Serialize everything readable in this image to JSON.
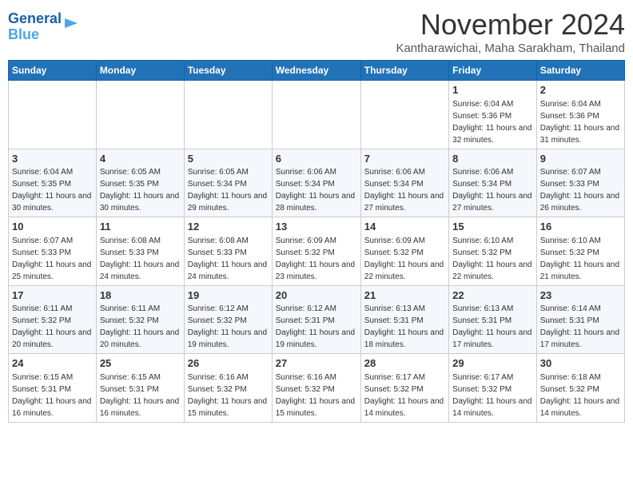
{
  "header": {
    "logo_line1": "General",
    "logo_line2": "Blue",
    "month": "November 2024",
    "location": "Kantharawichai, Maha Sarakham, Thailand"
  },
  "days_of_week": [
    "Sunday",
    "Monday",
    "Tuesday",
    "Wednesday",
    "Thursday",
    "Friday",
    "Saturday"
  ],
  "weeks": [
    [
      {
        "day": "",
        "info": ""
      },
      {
        "day": "",
        "info": ""
      },
      {
        "day": "",
        "info": ""
      },
      {
        "day": "",
        "info": ""
      },
      {
        "day": "",
        "info": ""
      },
      {
        "day": "1",
        "info": "Sunrise: 6:04 AM\nSunset: 5:36 PM\nDaylight: 11 hours and 32 minutes."
      },
      {
        "day": "2",
        "info": "Sunrise: 6:04 AM\nSunset: 5:36 PM\nDaylight: 11 hours and 31 minutes."
      }
    ],
    [
      {
        "day": "3",
        "info": "Sunrise: 6:04 AM\nSunset: 5:35 PM\nDaylight: 11 hours and 30 minutes."
      },
      {
        "day": "4",
        "info": "Sunrise: 6:05 AM\nSunset: 5:35 PM\nDaylight: 11 hours and 30 minutes."
      },
      {
        "day": "5",
        "info": "Sunrise: 6:05 AM\nSunset: 5:34 PM\nDaylight: 11 hours and 29 minutes."
      },
      {
        "day": "6",
        "info": "Sunrise: 6:06 AM\nSunset: 5:34 PM\nDaylight: 11 hours and 28 minutes."
      },
      {
        "day": "7",
        "info": "Sunrise: 6:06 AM\nSunset: 5:34 PM\nDaylight: 11 hours and 27 minutes."
      },
      {
        "day": "8",
        "info": "Sunrise: 6:06 AM\nSunset: 5:34 PM\nDaylight: 11 hours and 27 minutes."
      },
      {
        "day": "9",
        "info": "Sunrise: 6:07 AM\nSunset: 5:33 PM\nDaylight: 11 hours and 26 minutes."
      }
    ],
    [
      {
        "day": "10",
        "info": "Sunrise: 6:07 AM\nSunset: 5:33 PM\nDaylight: 11 hours and 25 minutes."
      },
      {
        "day": "11",
        "info": "Sunrise: 6:08 AM\nSunset: 5:33 PM\nDaylight: 11 hours and 24 minutes."
      },
      {
        "day": "12",
        "info": "Sunrise: 6:08 AM\nSunset: 5:33 PM\nDaylight: 11 hours and 24 minutes."
      },
      {
        "day": "13",
        "info": "Sunrise: 6:09 AM\nSunset: 5:32 PM\nDaylight: 11 hours and 23 minutes."
      },
      {
        "day": "14",
        "info": "Sunrise: 6:09 AM\nSunset: 5:32 PM\nDaylight: 11 hours and 22 minutes."
      },
      {
        "day": "15",
        "info": "Sunrise: 6:10 AM\nSunset: 5:32 PM\nDaylight: 11 hours and 22 minutes."
      },
      {
        "day": "16",
        "info": "Sunrise: 6:10 AM\nSunset: 5:32 PM\nDaylight: 11 hours and 21 minutes."
      }
    ],
    [
      {
        "day": "17",
        "info": "Sunrise: 6:11 AM\nSunset: 5:32 PM\nDaylight: 11 hours and 20 minutes."
      },
      {
        "day": "18",
        "info": "Sunrise: 6:11 AM\nSunset: 5:32 PM\nDaylight: 11 hours and 20 minutes."
      },
      {
        "day": "19",
        "info": "Sunrise: 6:12 AM\nSunset: 5:32 PM\nDaylight: 11 hours and 19 minutes."
      },
      {
        "day": "20",
        "info": "Sunrise: 6:12 AM\nSunset: 5:31 PM\nDaylight: 11 hours and 19 minutes."
      },
      {
        "day": "21",
        "info": "Sunrise: 6:13 AM\nSunset: 5:31 PM\nDaylight: 11 hours and 18 minutes."
      },
      {
        "day": "22",
        "info": "Sunrise: 6:13 AM\nSunset: 5:31 PM\nDaylight: 11 hours and 17 minutes."
      },
      {
        "day": "23",
        "info": "Sunrise: 6:14 AM\nSunset: 5:31 PM\nDaylight: 11 hours and 17 minutes."
      }
    ],
    [
      {
        "day": "24",
        "info": "Sunrise: 6:15 AM\nSunset: 5:31 PM\nDaylight: 11 hours and 16 minutes."
      },
      {
        "day": "25",
        "info": "Sunrise: 6:15 AM\nSunset: 5:31 PM\nDaylight: 11 hours and 16 minutes."
      },
      {
        "day": "26",
        "info": "Sunrise: 6:16 AM\nSunset: 5:32 PM\nDaylight: 11 hours and 15 minutes."
      },
      {
        "day": "27",
        "info": "Sunrise: 6:16 AM\nSunset: 5:32 PM\nDaylight: 11 hours and 15 minutes."
      },
      {
        "day": "28",
        "info": "Sunrise: 6:17 AM\nSunset: 5:32 PM\nDaylight: 11 hours and 14 minutes."
      },
      {
        "day": "29",
        "info": "Sunrise: 6:17 AM\nSunset: 5:32 PM\nDaylight: 11 hours and 14 minutes."
      },
      {
        "day": "30",
        "info": "Sunrise: 6:18 AM\nSunset: 5:32 PM\nDaylight: 11 hours and 14 minutes."
      }
    ]
  ]
}
